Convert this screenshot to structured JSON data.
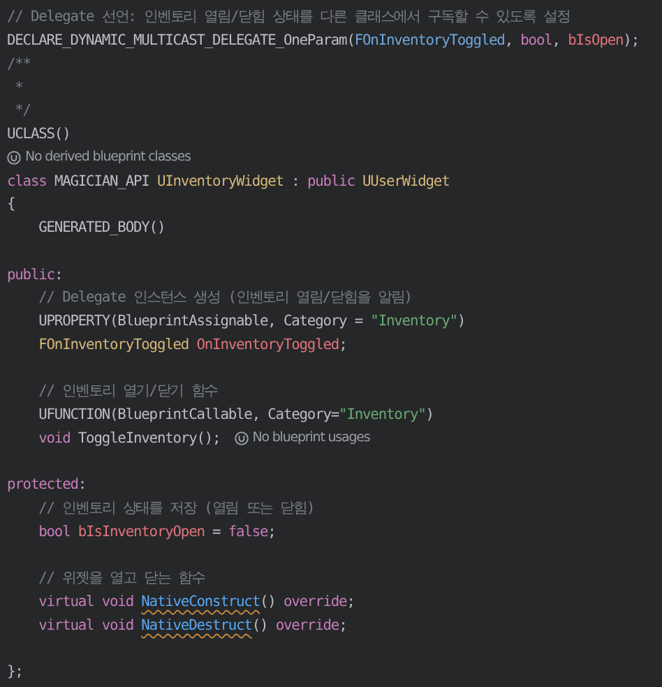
{
  "lines": [
    {
      "kind": "code",
      "tokens": [
        {
          "text": "// Delegate 선언: 인벤토리 열림/닫힘 상태를 다른 클래스에서 구독할 수 있도록 설정",
          "kind": "comment"
        }
      ]
    },
    {
      "kind": "code",
      "tokens": [
        {
          "text": "DECLARE_DYNAMIC_MULTICAST_DELEGATE_OneParam(",
          "kind": "plain"
        },
        {
          "text": "FOnInventoryToggled",
          "kind": "param"
        },
        {
          "text": ", ",
          "kind": "plain"
        },
        {
          "text": "bool",
          "kind": "keyword"
        },
        {
          "text": ", ",
          "kind": "plain"
        },
        {
          "text": "bIsOpen",
          "kind": "field"
        },
        {
          "text": ");",
          "kind": "plain"
        }
      ]
    },
    {
      "kind": "code",
      "tokens": [
        {
          "text": "/**",
          "kind": "comment"
        }
      ]
    },
    {
      "kind": "code",
      "tokens": [
        {
          "text": " *",
          "kind": "comment"
        }
      ]
    },
    {
      "kind": "code",
      "tokens": [
        {
          "text": " */",
          "kind": "comment"
        }
      ]
    },
    {
      "kind": "code",
      "tokens": [
        {
          "text": "UCLASS()",
          "kind": "plain"
        }
      ]
    },
    {
      "kind": "hint",
      "text": "No derived blueprint classes"
    },
    {
      "kind": "code",
      "tokens": [
        {
          "text": "class ",
          "kind": "keyword"
        },
        {
          "text": "MAGICIAN_API ",
          "kind": "plain"
        },
        {
          "text": "UInventoryWidget",
          "kind": "type"
        },
        {
          "text": " : ",
          "kind": "plain"
        },
        {
          "text": "public ",
          "kind": "keyword"
        },
        {
          "text": "UUserWidget",
          "kind": "type"
        }
      ]
    },
    {
      "kind": "code",
      "tokens": [
        {
          "text": "{",
          "kind": "plain"
        }
      ]
    },
    {
      "kind": "code",
      "tokens": [
        {
          "text": "    GENERATED_BODY()",
          "kind": "plain"
        }
      ]
    },
    {
      "kind": "blank"
    },
    {
      "kind": "code",
      "tokens": [
        {
          "text": "public",
          "kind": "keyword"
        },
        {
          "text": ":",
          "kind": "plain"
        }
      ]
    },
    {
      "kind": "code",
      "tokens": [
        {
          "text": "    // Delegate 인스턴스 생성 (인벤토리 열림/닫힘을 알림)",
          "kind": "comment"
        }
      ]
    },
    {
      "kind": "code",
      "tokens": [
        {
          "text": "    UPROPERTY(BlueprintAssignable, Category = ",
          "kind": "plain"
        },
        {
          "text": "\"Inventory\"",
          "kind": "string"
        },
        {
          "text": ")",
          "kind": "plain"
        }
      ]
    },
    {
      "kind": "code",
      "tokens": [
        {
          "text": "    FOnInventoryToggled ",
          "kind": "type"
        },
        {
          "text": "OnInventoryToggled",
          "kind": "field"
        },
        {
          "text": ";",
          "kind": "plain"
        }
      ]
    },
    {
      "kind": "blank"
    },
    {
      "kind": "code",
      "tokens": [
        {
          "text": "    // 인벤토리 열기/닫기 함수",
          "kind": "comment"
        }
      ]
    },
    {
      "kind": "code",
      "tokens": [
        {
          "text": "    UFUNCTION(BlueprintCallable, Category=",
          "kind": "plain"
        },
        {
          "text": "\"Inventory\"",
          "kind": "string"
        },
        {
          "text": ")",
          "kind": "plain"
        }
      ]
    },
    {
      "kind": "code",
      "tokens": [
        {
          "text": "    void ",
          "kind": "keyword"
        },
        {
          "text": "ToggleInventory();",
          "kind": "plain"
        }
      ],
      "hint": "No blueprint usages"
    },
    {
      "kind": "blank"
    },
    {
      "kind": "code",
      "tokens": [
        {
          "text": "protected",
          "kind": "keyword"
        },
        {
          "text": ":",
          "kind": "plain"
        }
      ]
    },
    {
      "kind": "code",
      "tokens": [
        {
          "text": "    // 인벤토리 상태를 저장 (열림 또는 닫힘)",
          "kind": "comment"
        }
      ]
    },
    {
      "kind": "code",
      "tokens": [
        {
          "text": "    bool ",
          "kind": "keyword"
        },
        {
          "text": "bIsInventoryOpen",
          "kind": "field"
        },
        {
          "text": " = ",
          "kind": "plain"
        },
        {
          "text": "false",
          "kind": "keyword"
        },
        {
          "text": ";",
          "kind": "plain"
        }
      ]
    },
    {
      "kind": "blank"
    },
    {
      "kind": "code",
      "tokens": [
        {
          "text": "    // 위젯을 열고 닫는 함수",
          "kind": "comment"
        }
      ]
    },
    {
      "kind": "code",
      "tokens": [
        {
          "text": "    virtual void ",
          "kind": "keyword"
        },
        {
          "text": "NativeConstruct",
          "kind": "warning"
        },
        {
          "text": "() ",
          "kind": "plain"
        },
        {
          "text": "override",
          "kind": "keyword"
        },
        {
          "text": ";",
          "kind": "plain"
        }
      ]
    },
    {
      "kind": "code",
      "tokens": [
        {
          "text": "    virtual void ",
          "kind": "keyword"
        },
        {
          "text": "NativeDestruct",
          "kind": "warning"
        },
        {
          "text": "() ",
          "kind": "plain"
        },
        {
          "text": "override",
          "kind": "keyword"
        },
        {
          "text": ";",
          "kind": "plain"
        }
      ]
    },
    {
      "kind": "blank"
    },
    {
      "kind": "code",
      "tokens": [
        {
          "text": "};",
          "kind": "plain"
        }
      ]
    }
  ]
}
